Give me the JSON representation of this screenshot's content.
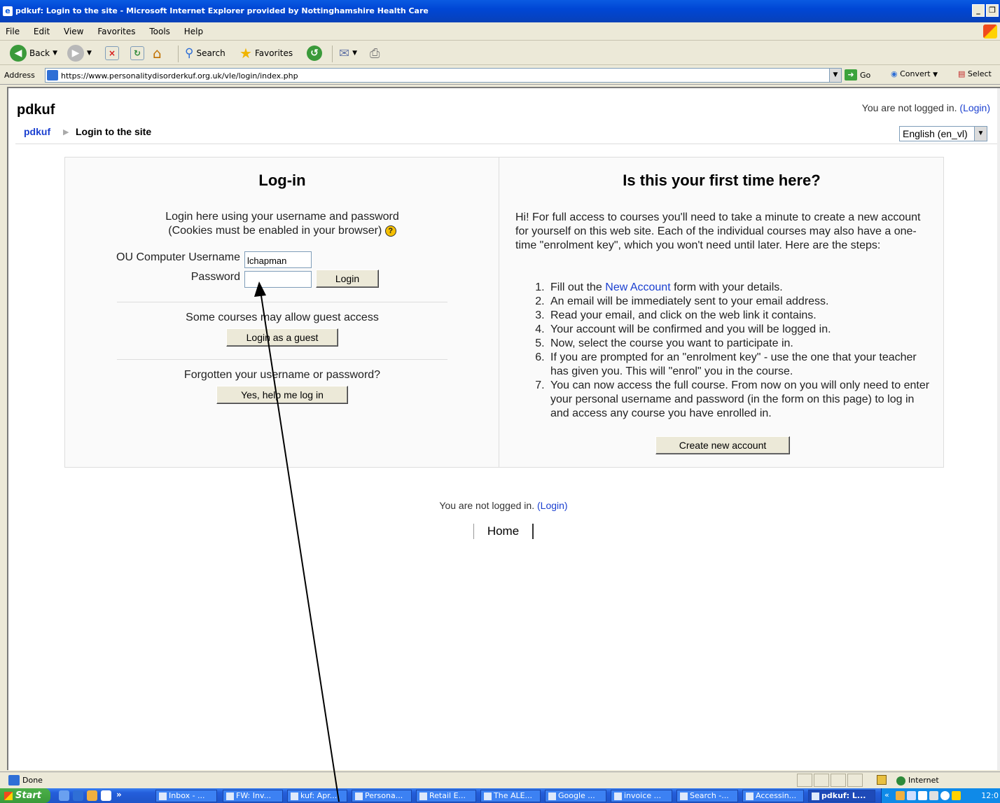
{
  "window": {
    "title": "pdkuf: Login to the site - Microsoft Internet Explorer provided by Nottinghamshire Health Care",
    "controls": [
      "_",
      "❐",
      "×"
    ]
  },
  "menu": [
    "File",
    "Edit",
    "View",
    "Favorites",
    "Tools",
    "Help"
  ],
  "toolbar": {
    "back": "Back",
    "search": "Search",
    "favorites": "Favorites"
  },
  "address": {
    "label": "Address",
    "url": "https://www.personalitydisorderkuf.org.uk/vle/login/index.php",
    "go": "Go",
    "convert": "Convert",
    "select": "Select"
  },
  "page": {
    "site_name": "pdkuf",
    "status_prefix": "You are not logged in.",
    "status_link": "(Login)",
    "breadcrumb": [
      "pdkuf",
      "Login to the site"
    ],
    "language": "English (en_vl)",
    "login": {
      "heading": "Log-in",
      "intro_line1": "Login here using your username and password",
      "intro_line2": "(Cookies must be enabled in your browser)",
      "username_label": "OU Computer Username",
      "username_value": "lchapman",
      "password_label": "Password",
      "password_value": "",
      "login_button": "Login",
      "guest_text": "Some courses may allow guest access",
      "guest_button": "Login as a guest",
      "forgot_text": "Forgotten your username or password?",
      "forgot_button": "Yes, help me log in"
    },
    "signup": {
      "heading": "Is this your first time here?",
      "intro": "Hi! For full access to courses you'll need to take a minute to create a new account for yourself on this web site. Each of the individual courses may also have a one-time \"enrolment key\", which you won't need until later. Here are the steps:",
      "step1_prefix": "Fill out the",
      "step1_link": "New Account",
      "step1_suffix": "form with your details.",
      "steps": [
        "An email will be immediately sent to your email address.",
        "Read your email, and click on the web link it contains.",
        "Your account will be confirmed and you will be logged in.",
        "Now, select the course you want to participate in.",
        "If you are prompted for an \"enrolment key\" - use the one that your teacher has given you. This will \"enrol\" you in the course.",
        "You can now access the full course. From now on you will only need to enter your personal username and password (in the form on this page) to log in and access any course you have enrolled in."
      ],
      "create_button": "Create new account"
    },
    "footer_status_prefix": "You are not logged in.",
    "footer_status_link": "(Login)",
    "home_link": "Home"
  },
  "statusbar": {
    "text": "Done",
    "zone": "Internet"
  },
  "taskbar": {
    "start": "Start",
    "tasks": [
      "Inbox - ...",
      "FW: Inv...",
      "kuf: Apr...",
      "Persona...",
      "Retail E...",
      "The ALE...",
      "Google ...",
      "invoice ...",
      "Search -...",
      "Accessin...",
      "pdkuf: L..."
    ],
    "clock": "12:0"
  },
  "colors": {
    "link": "#1a3fd0",
    "titlebar": "#0a5be2",
    "taskbar": "#245edb"
  }
}
